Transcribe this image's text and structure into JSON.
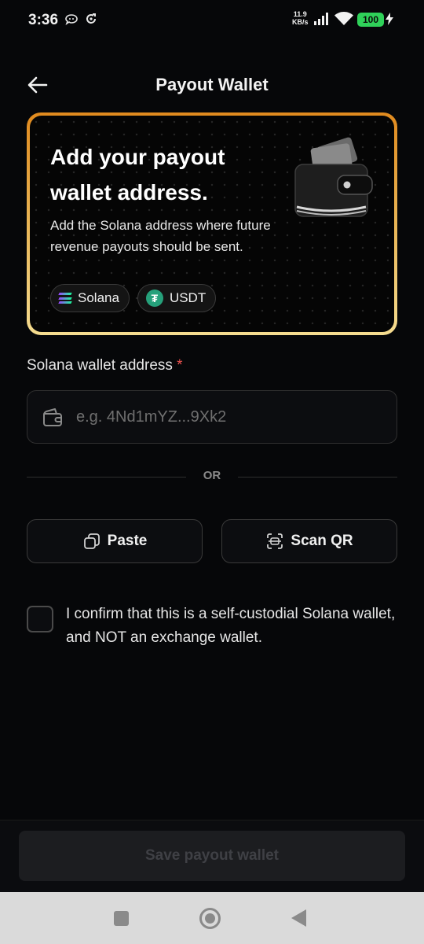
{
  "status_bar": {
    "time": "3:36",
    "net_speed_value": "11.9",
    "net_speed_unit": "KB/s",
    "battery": "100",
    "icons": [
      "notification-icon",
      "sync-icon",
      "signal-icon",
      "wifi-icon",
      "battery-icon",
      "charging-icon"
    ]
  },
  "header": {
    "title": "Payout Wallet",
    "back_icon": "arrow-left-icon"
  },
  "card": {
    "heading": "Add your payout wallet address.",
    "description": "Add the Solana address where future revenue payouts should be sent.",
    "chips": [
      {
        "label": "Solana",
        "icon": "solana-icon"
      },
      {
        "label": "USDT",
        "icon": "tether-icon"
      }
    ],
    "image": "wallet-illustration",
    "border_colors": [
      "#e08a1e",
      "#f5dc90"
    ]
  },
  "form": {
    "label": "Solana wallet address",
    "required_mark": "*",
    "placeholder": "e.g. 4Nd1mYZ...9Xk2",
    "value": "",
    "input_icon": "wallet-icon",
    "divider_text": "OR",
    "paste_label": "Paste",
    "scan_label": "Scan QR",
    "confirm_text": "I confirm that this is a self-custodial Solana wallet, and NOT an exchange wallet.",
    "confirm_checked": false
  },
  "footer": {
    "save_label": "Save payout wallet",
    "save_enabled": false
  },
  "colors": {
    "background": "#060709",
    "required": "#ef5350",
    "battery": "#2fd159",
    "usdt": "#26a17b"
  }
}
